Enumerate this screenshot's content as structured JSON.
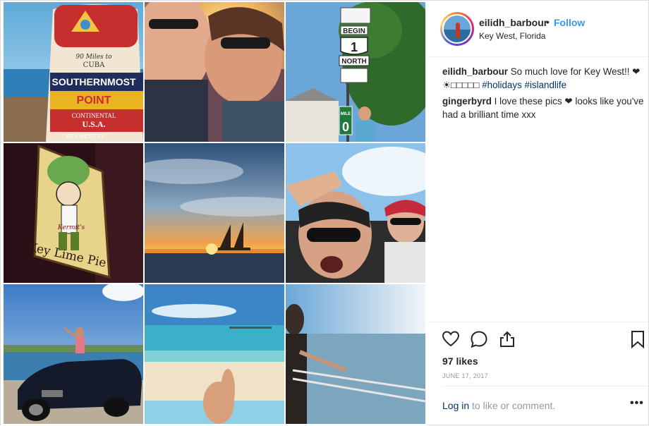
{
  "post": {
    "username": "eilidh_barbour",
    "separator": "•",
    "follow_label": "Follow",
    "location": "Key West, Florida",
    "caption": {
      "username": "eilidh_barbour",
      "text": "So much love for Key West!! ❤ ☀□□□□□",
      "hashtags": [
        "#holidays",
        "#islandlife"
      ]
    },
    "comments": [
      {
        "username": "gingerbyrd",
        "text": "I love these pics ❤ looks like you've had a brilliant time xxx"
      }
    ],
    "likes": "97 likes",
    "date": "JUNE 17, 2017",
    "login_link": "Log in",
    "login_rest": "to like or comment.",
    "more_label": "•••"
  },
  "photos": [
    {
      "name": "photo-southernmost-point",
      "texts": [
        "90 Miles to",
        "CUBA",
        "SOUTHERNMOST",
        "POINT",
        "CONTINENTAL",
        "U.S.A.",
        "KEY WEST, FL"
      ]
    },
    {
      "name": "photo-couple-selfie-sunset"
    },
    {
      "name": "photo-us1-mile-zero",
      "texts": [
        "BEGIN",
        "1",
        "NORTH",
        "MILE",
        "0"
      ]
    },
    {
      "name": "photo-key-lime-pie-sign",
      "texts": [
        "Key Lime Pie",
        "Kermit's"
      ]
    },
    {
      "name": "photo-sailboat-sunset"
    },
    {
      "name": "photo-convertible-selfie"
    },
    {
      "name": "photo-convertible-car"
    },
    {
      "name": "photo-beach-towel"
    },
    {
      "name": "photo-ocean-railing"
    }
  ],
  "icons": {
    "like": "heart-icon",
    "comment": "comment-bubble-icon",
    "share": "share-icon",
    "save": "bookmark-icon"
  },
  "colors": {
    "follow": "#3897f0",
    "hashtag": "#003569",
    "muted": "#999999"
  }
}
